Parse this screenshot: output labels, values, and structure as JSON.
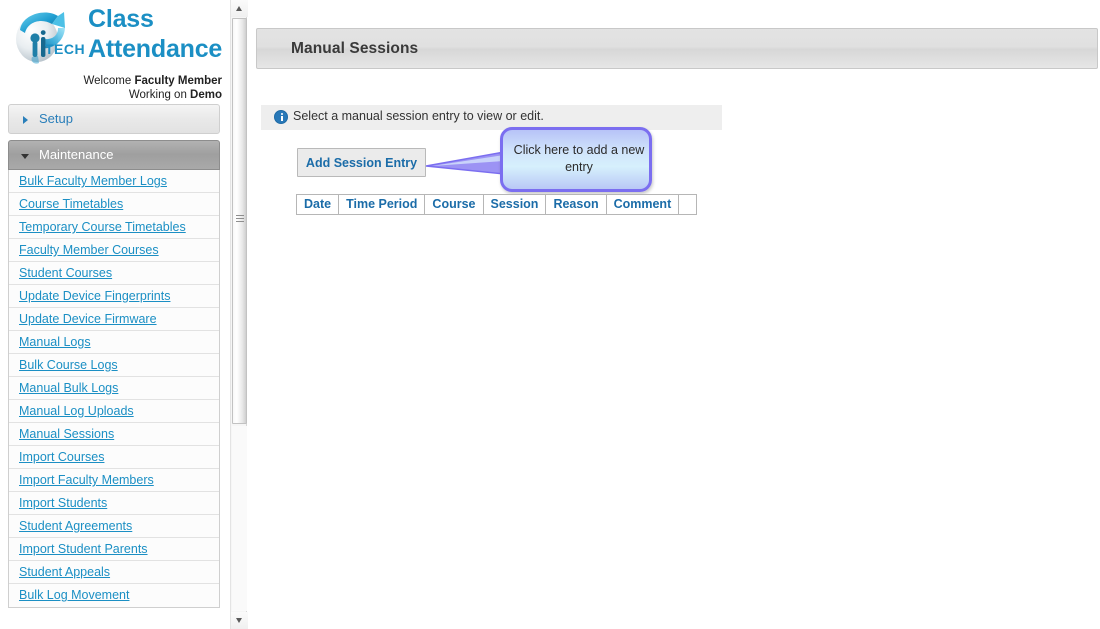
{
  "brand": {
    "logo_icon": "ip-tech-sphere-logo",
    "title_line1": "Class",
    "title_line2": "Attendance",
    "welcome_prefix": "Welcome ",
    "welcome_user": "Faculty Member",
    "working_prefix": "Working on ",
    "working_target": "Demo"
  },
  "sidebar": {
    "sections": [
      {
        "label": "Setup",
        "expanded": false,
        "icon": "chevron-right-icon"
      },
      {
        "label": "Maintenance",
        "expanded": true,
        "icon": "chevron-down-icon"
      }
    ],
    "items": [
      {
        "label": "Bulk Faculty Member Logs"
      },
      {
        "label": "Course Timetables"
      },
      {
        "label": "Temporary Course Timetables"
      },
      {
        "label": "Faculty Member Courses"
      },
      {
        "label": "Student Courses"
      },
      {
        "label": "Update Device Fingerprints"
      },
      {
        "label": "Update Device Firmware"
      },
      {
        "label": "Manual Logs"
      },
      {
        "label": "Bulk Course Logs"
      },
      {
        "label": "Manual Bulk Logs"
      },
      {
        "label": "Manual Log Uploads"
      },
      {
        "label": "Manual Sessions"
      },
      {
        "label": "Import Courses"
      },
      {
        "label": "Import Faculty Members"
      },
      {
        "label": "Import Students"
      },
      {
        "label": "Student Agreements"
      },
      {
        "label": "Import Student Parents"
      },
      {
        "label": "Student Appeals"
      },
      {
        "label": "Bulk Log Movement"
      }
    ],
    "scrollbar": {
      "up_icon": "scroll-up-arrow-icon",
      "down_icon": "scroll-down-arrow-icon",
      "grip_icon": "scroll-grip-icon"
    }
  },
  "main": {
    "page_title": "Manual Sessions",
    "info": {
      "icon": "info-circle-icon",
      "message": "Select a manual session entry to view or edit."
    },
    "add_button_label": "Add Session Entry",
    "callout": {
      "text": "Click here to add a new entry",
      "border_color": "#7b6ef0",
      "fill_from": "#b7c3f7",
      "fill_to": "#d6f0fc"
    },
    "table": {
      "columns": [
        "Date",
        "Time Period",
        "Course",
        "Session",
        "Reason",
        "Comment"
      ],
      "rows": []
    }
  },
  "colors": {
    "brand_blue": "#1b8fc4",
    "link_blue": "#1b8fc4",
    "header_gray": "#e0e0e0",
    "active_section_gray": "#a0a0a0",
    "info_bar_gray": "#eeeeee",
    "table_header_blue": "#1b6ca8"
  }
}
